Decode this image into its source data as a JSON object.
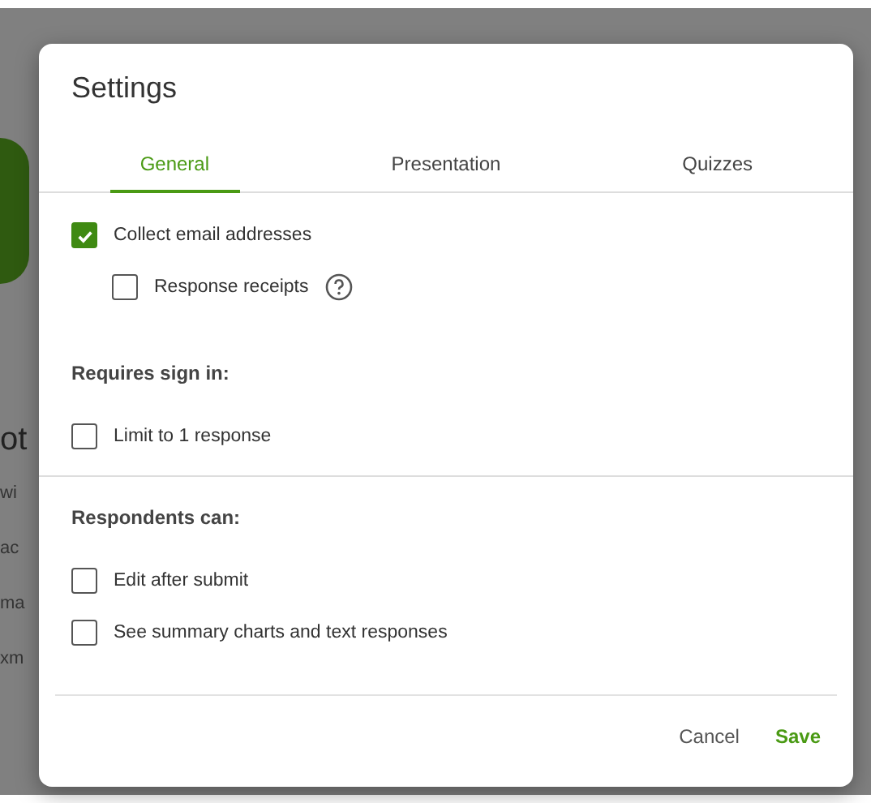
{
  "background": {
    "fragments": [
      "ot",
      "wi",
      "ac",
      "ma",
      "xm"
    ]
  },
  "dialog": {
    "title": "Settings",
    "tabs": [
      {
        "label": "General",
        "selected": true
      },
      {
        "label": "Presentation",
        "selected": false
      },
      {
        "label": "Quizzes",
        "selected": false
      }
    ],
    "sections": [
      {
        "items": [
          {
            "label": "Collect email addresses",
            "checked": true,
            "children": [
              {
                "label": "Response receipts",
                "checked": false,
                "help": true
              }
            ]
          }
        ]
      },
      {
        "heading": "Requires sign in:",
        "items": [
          {
            "label": "Limit to 1 response",
            "checked": false
          }
        ]
      },
      {
        "heading": "Respondents can:",
        "items": [
          {
            "label": "Edit after submit",
            "checked": false
          },
          {
            "label": "See summary charts and text responses",
            "checked": false
          }
        ]
      }
    ],
    "buttons": [
      {
        "label": "Cancel",
        "kind": "secondary"
      },
      {
        "label": "Save",
        "kind": "primary"
      }
    ]
  }
}
